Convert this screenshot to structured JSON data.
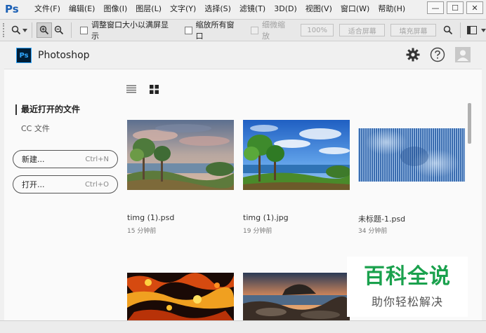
{
  "titlebar": {
    "logo": "Ps",
    "menu": [
      "文件(F)",
      "编辑(E)",
      "图像(I)",
      "图层(L)",
      "文字(Y)",
      "选择(S)",
      "滤镜(T)",
      "3D(D)",
      "视图(V)",
      "窗口(W)",
      "帮助(H)"
    ],
    "window_buttons": [
      "—",
      "☐",
      "✕"
    ]
  },
  "toolbar": {
    "resize_window_label": "调整窗口大小以满屏显示",
    "zoom_all_label": "缩放所有窗口",
    "scrubby_zoom_label": "细微缩放",
    "zoom_percent_label": "100%",
    "fit_screen_label": "适合屏幕",
    "fill_screen_label": "填充屏幕"
  },
  "header": {
    "badge": "Ps",
    "title": "Photoshop"
  },
  "sidebar": {
    "recent_label": "最近打开的文件",
    "cc_label": "CC 文件",
    "new_label": "新建...",
    "new_shortcut": "Ctrl+N",
    "open_label": "打开...",
    "open_shortcut": "Ctrl+O"
  },
  "files": [
    {
      "name": "timg (1).psd",
      "time": "15 分钟前"
    },
    {
      "name": "timg (1).jpg",
      "time": "19 分钟前"
    },
    {
      "name": "未标题-1.psd",
      "time": "34 分钟前"
    },
    {
      "name": "",
      "time": ""
    },
    {
      "name": "",
      "time": ""
    }
  ],
  "watermark": {
    "title": "百科全说",
    "subtitle": "助你轻松解决"
  },
  "colors": {
    "ps_blue": "#31a8ff",
    "ps_dark": "#001e36",
    "watermark_green": "#1aa14d"
  },
  "icons": {
    "settings": "gear-icon",
    "help": "help-icon",
    "account": "avatar-icon",
    "list_view": "list-view-icon",
    "grid_view": "grid-view-icon"
  }
}
